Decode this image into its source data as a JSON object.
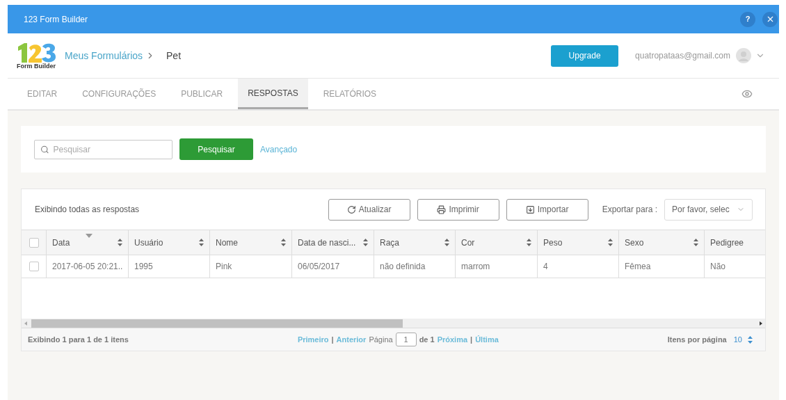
{
  "window": {
    "title": "123 Form Builder",
    "buttons": [
      {
        "kind": "help",
        "label": "?"
      },
      {
        "kind": "close"
      }
    ]
  },
  "header": {
    "logo_caption": "Form Builder",
    "breadcrumb": "Meus Formulários",
    "current": "Pet",
    "upgrade": "Upgrade",
    "email": "quatropataas@gmail.com"
  },
  "tabs": [
    {
      "label": "EDITAR",
      "selected": false
    },
    {
      "label": "CONFIGURAÇÕES",
      "selected": false
    },
    {
      "label": "PUBLICAR",
      "selected": false
    },
    {
      "label": "RESPOSTAS",
      "selected": true
    },
    {
      "label": "RELATÓRIOS",
      "selected": false
    }
  ],
  "search": {
    "placeholder": "Pesquisar",
    "button": "Pesquisar",
    "advanced": "Avançado"
  },
  "toolbar": {
    "caption": "Exibindo todas as respostas",
    "buttons": [
      {
        "kind": "refresh",
        "label": "Atualizar"
      },
      {
        "kind": "print",
        "label": "Imprimir"
      },
      {
        "kind": "import",
        "label": "Importar"
      }
    ],
    "export_label": "Exportar para :",
    "export_value": "Por favor, selec"
  },
  "table": {
    "columns": [
      {
        "label": "Data",
        "sorted": true,
        "sortable": true
      },
      {
        "label": "Usuário",
        "sorted": false,
        "sortable": true
      },
      {
        "label": "Nome",
        "sorted": false,
        "sortable": true
      },
      {
        "label": "Data de nasci...",
        "sorted": false,
        "sortable": true
      },
      {
        "label": "Raça",
        "sorted": false,
        "sortable": true
      },
      {
        "label": "Cor",
        "sorted": false,
        "sortable": true
      },
      {
        "label": "Peso",
        "sorted": false,
        "sortable": true
      },
      {
        "label": "Sexo",
        "sorted": false,
        "sortable": true
      },
      {
        "label": "Pedigree",
        "sorted": false,
        "sortable": false
      }
    ],
    "header_checked": false,
    "rows": [
      {
        "checked": false,
        "cells": [
          "2017-06-05 20:21..",
          "1995",
          "Pink",
          "06/05/2017",
          "não definida",
          "marrom",
          "4",
          "Fêmea",
          "Não"
        ]
      }
    ]
  },
  "pager": {
    "summary": "Exibindo 1 para 1 de 1 itens",
    "first": "Primeiro",
    "sep1": "|",
    "prev": "Anterior",
    "page_label": "Página",
    "page": "1",
    "of": "de 1",
    "next": "Próxima",
    "sep2": "|",
    "last": "Última",
    "per_page_label": "Itens por página",
    "per_page": "10"
  }
}
